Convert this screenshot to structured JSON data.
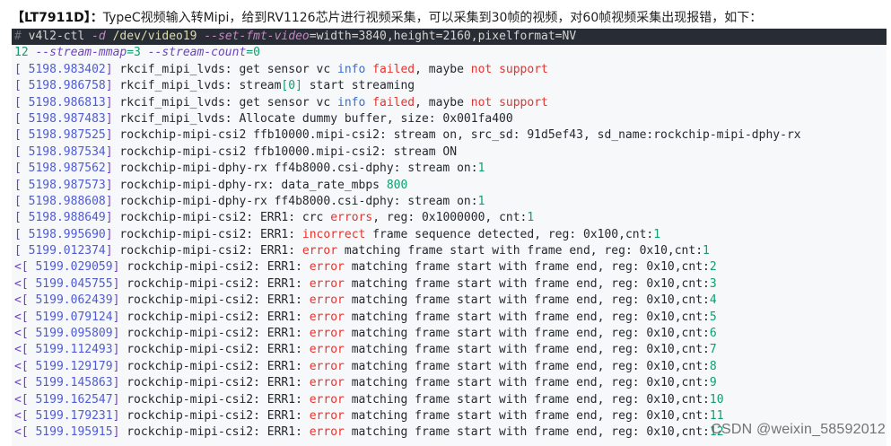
{
  "caption": {
    "tag": "【LT7911D】：",
    "text": "TypeC视频输入转Mipi，给到RV1126芯片进行视频采集，可以采集到30帧的视频，对60帧视频采集出现报错，如下："
  },
  "command": {
    "prompt": "# ",
    "exe": "v4l2-ctl",
    "flag1": " -d",
    "path": " /dev/video19",
    "flag2": " --set-fmt-video",
    "args": "=width=3840,height=2160,pixelformat=NV",
    "cont_num": "12",
    "flag3": " --stream-mmap",
    "eq1": "=3",
    "flag4": " --stream-count",
    "eq2": "=0"
  },
  "log": [
    {
      "p": "[ ",
      "ts": "5198.983402",
      "b": "]",
      "segs": [
        [
          "n",
          " rkcif_mipi_lvds: get sensor vc "
        ],
        [
          "i",
          "info"
        ],
        [
          "r",
          " failed"
        ],
        [
          "n",
          ", maybe "
        ],
        [
          "r",
          "not"
        ],
        [
          "n",
          " "
        ],
        [
          "r",
          "support"
        ]
      ]
    },
    {
      "p": "[ ",
      "ts": "5198.986758",
      "b": "]",
      "segs": [
        [
          "n",
          " rkcif_mipi_lvds: stream"
        ],
        [
          "g",
          "[0]"
        ],
        [
          "n",
          " start streaming"
        ]
      ]
    },
    {
      "p": "[ ",
      "ts": "5198.986813",
      "b": "]",
      "segs": [
        [
          "n",
          " rkcif_mipi_lvds: get sensor vc "
        ],
        [
          "i",
          "info"
        ],
        [
          "r",
          " failed"
        ],
        [
          "n",
          ", maybe "
        ],
        [
          "r",
          "not"
        ],
        [
          "n",
          " "
        ],
        [
          "r",
          "support"
        ]
      ]
    },
    {
      "p": "[ ",
      "ts": "5198.987483",
      "b": "]",
      "segs": [
        [
          "n",
          " rkcif_mipi_lvds: Allocate dummy buffer, size: 0x001fa400"
        ]
      ]
    },
    {
      "p": "[ ",
      "ts": "5198.987525",
      "b": "]",
      "segs": [
        [
          "n",
          " rockchip-mipi-csi2 ffb10000.mipi-csi2: stream on, src_sd: 91d5ef43, sd_name:rockchip-mipi-dphy-rx"
        ]
      ]
    },
    {
      "p": "[ ",
      "ts": "5198.987534",
      "b": "]",
      "segs": [
        [
          "n",
          " rockchip-mipi-csi2 ffb10000.mipi-csi2: stream ON"
        ]
      ]
    },
    {
      "p": "[ ",
      "ts": "5198.987562",
      "b": "]",
      "segs": [
        [
          "n",
          " rockchip-mipi-dphy-rx ff4b8000.csi-dphy: stream on:"
        ],
        [
          "g",
          "1"
        ]
      ]
    },
    {
      "p": "[ ",
      "ts": "5198.987573",
      "b": "]",
      "segs": [
        [
          "n",
          " rockchip-mipi-dphy-rx: data_rate_mbps "
        ],
        [
          "g",
          "800"
        ]
      ]
    },
    {
      "p": "[ ",
      "ts": "5198.988608",
      "b": "]",
      "segs": [
        [
          "n",
          " rockchip-mipi-dphy-rx ff4b8000.csi-dphy: stream on:"
        ],
        [
          "g",
          "1"
        ]
      ]
    },
    {
      "p": "[ ",
      "ts": "5198.988649",
      "b": "]",
      "segs": [
        [
          "n",
          " rockchip-mipi-csi2: ERR1: crc "
        ],
        [
          "r",
          "errors"
        ],
        [
          "n",
          ", reg: 0x1000000, cnt:"
        ],
        [
          "g",
          "1"
        ]
      ]
    },
    {
      "p": "[ ",
      "ts": "5198.995690",
      "b": "]",
      "segs": [
        [
          "n",
          " rockchip-mipi-csi2: ERR1: "
        ],
        [
          "r",
          "incorrect"
        ],
        [
          "n",
          " frame sequence detected, reg: 0x100,cnt:"
        ],
        [
          "g",
          "1"
        ]
      ]
    },
    {
      "p": "[ ",
      "ts": "5199.012374",
      "b": "]",
      "segs": [
        [
          "n",
          " rockchip-mipi-csi2: ERR1: "
        ],
        [
          "r",
          "error"
        ],
        [
          "n",
          " matching frame start with frame end, reg: 0x10,cnt:"
        ],
        [
          "g",
          "1"
        ]
      ]
    },
    {
      "p": "<[ ",
      "ts": "5199.029059",
      "b": "]",
      "segs": [
        [
          "n",
          " rockchip-mipi-csi2: ERR1: "
        ],
        [
          "r",
          "error"
        ],
        [
          "n",
          " matching frame start with frame end, reg: 0x10,cnt:"
        ],
        [
          "g",
          "2"
        ]
      ]
    },
    {
      "p": "<[ ",
      "ts": "5199.045755",
      "b": "]",
      "segs": [
        [
          "n",
          " rockchip-mipi-csi2: ERR1: "
        ],
        [
          "r",
          "error"
        ],
        [
          "n",
          " matching frame start with frame end, reg: 0x10,cnt:"
        ],
        [
          "g",
          "3"
        ]
      ]
    },
    {
      "p": "<[ ",
      "ts": "5199.062439",
      "b": "]",
      "segs": [
        [
          "n",
          " rockchip-mipi-csi2: ERR1: "
        ],
        [
          "r",
          "error"
        ],
        [
          "n",
          " matching frame start with frame end, reg: 0x10,cnt:"
        ],
        [
          "g",
          "4"
        ]
      ]
    },
    {
      "p": "<[ ",
      "ts": "5199.079124",
      "b": "]",
      "segs": [
        [
          "n",
          " rockchip-mipi-csi2: ERR1: "
        ],
        [
          "r",
          "error"
        ],
        [
          "n",
          " matching frame start with frame end, reg: 0x10,cnt:"
        ],
        [
          "g",
          "5"
        ]
      ]
    },
    {
      "p": "<[ ",
      "ts": "5199.095809",
      "b": "]",
      "segs": [
        [
          "n",
          " rockchip-mipi-csi2: ERR1: "
        ],
        [
          "r",
          "error"
        ],
        [
          "n",
          " matching frame start with frame end, reg: 0x10,cnt:"
        ],
        [
          "g",
          "6"
        ]
      ]
    },
    {
      "p": "<[ ",
      "ts": "5199.112493",
      "b": "]",
      "segs": [
        [
          "n",
          " rockchip-mipi-csi2: ERR1: "
        ],
        [
          "r",
          "error"
        ],
        [
          "n",
          " matching frame start with frame end, reg: 0x10,cnt:"
        ],
        [
          "g",
          "7"
        ]
      ]
    },
    {
      "p": "<[ ",
      "ts": "5199.129179",
      "b": "]",
      "segs": [
        [
          "n",
          " rockchip-mipi-csi2: ERR1: "
        ],
        [
          "r",
          "error"
        ],
        [
          "n",
          " matching frame start with frame end, reg: 0x10,cnt:"
        ],
        [
          "g",
          "8"
        ]
      ]
    },
    {
      "p": "<[ ",
      "ts": "5199.145863",
      "b": "]",
      "segs": [
        [
          "n",
          " rockchip-mipi-csi2: ERR1: "
        ],
        [
          "r",
          "error"
        ],
        [
          "n",
          " matching frame start with frame end, reg: 0x10,cnt:"
        ],
        [
          "g",
          "9"
        ]
      ]
    },
    {
      "p": "<[ ",
      "ts": "5199.162547",
      "b": "]",
      "segs": [
        [
          "n",
          " rockchip-mipi-csi2: ERR1: "
        ],
        [
          "r",
          "error"
        ],
        [
          "n",
          " matching frame start with frame end, reg: 0x10,cnt:"
        ],
        [
          "g",
          "10"
        ]
      ]
    },
    {
      "p": "<[ ",
      "ts": "5199.179231",
      "b": "]",
      "segs": [
        [
          "n",
          " rockchip-mipi-csi2: ERR1: "
        ],
        [
          "r",
          "error"
        ],
        [
          "n",
          " matching frame start with frame end, reg: 0x10,cnt:"
        ],
        [
          "g",
          "11"
        ]
      ]
    },
    {
      "p": "<[ ",
      "ts": "5199.195915",
      "b": "]",
      "segs": [
        [
          "n",
          " rockchip-mipi-csi2: ERR1: "
        ],
        [
          "r",
          "error"
        ],
        [
          "n",
          " matching frame start with frame end, reg: 0x10,cnt:"
        ],
        [
          "g",
          "12"
        ]
      ]
    }
  ],
  "watermark": "CSDN @weixin_58592012",
  "colors": {
    "timestamp": "#4f5bd5",
    "error": "#e3342f",
    "info": "#2f6fde",
    "number": "#0e9f6e",
    "code_background": "#f6f8fa",
    "command_background": "#282c34"
  }
}
